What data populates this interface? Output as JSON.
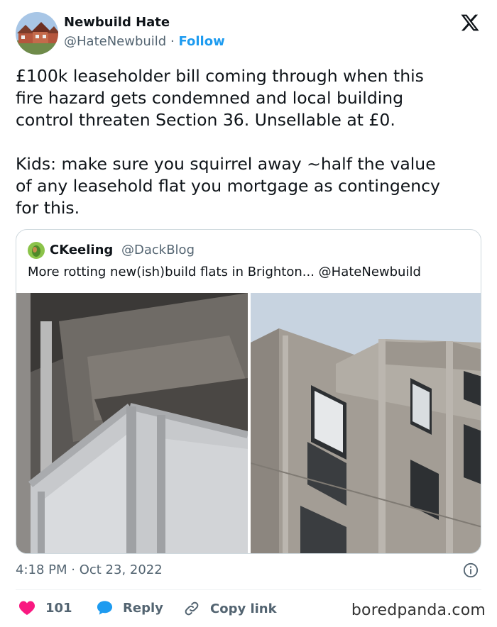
{
  "author": {
    "name": "Newbuild Hate",
    "handle": "@HateNewbuild",
    "separator": "·",
    "follow_label": "Follow",
    "avatar_icon": "houses-avatar"
  },
  "tweet": {
    "text": "£100k leaseholder bill coming through when this\nfire hazard gets condemned and local building\ncontrol threaten Section 36. Unsellable at £0.\n\nKids: make sure you squirrel away ~half the value\nof any leasehold flat you mortgage as contingency\nfor this.",
    "timestamp": "4:18 PM · Oct 23, 2022"
  },
  "quote": {
    "name": "CKeeling",
    "handle": "@DackBlog",
    "text": "More rotting new(ish)build flats in Brighton... @HateNewbuild",
    "avatar_icon": "leaf-avatar",
    "photos": [
      "balcony-underside-photo",
      "concrete-flats-facade-photo"
    ]
  },
  "actions": {
    "like_count": "101",
    "reply_label": "Reply",
    "copy_link_label": "Copy link"
  },
  "watermark": "boredpanda.com",
  "colors": {
    "accent": "#1d9bf0",
    "like": "#f91880",
    "muted": "#536471"
  }
}
